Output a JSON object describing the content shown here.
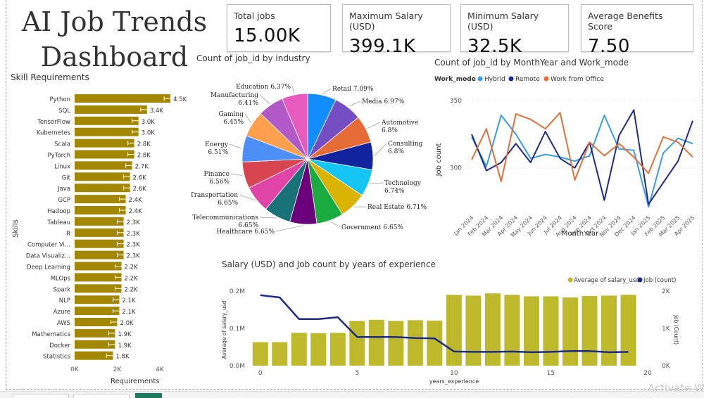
{
  "title": "AI Job Trends Dashboard",
  "kpis": [
    {
      "label": "Total jobs",
      "value": "15.00K"
    },
    {
      "label": "Maximum Salary (USD)",
      "value": "399.1K"
    },
    {
      "label": "Minimum Salary (USD)",
      "value": "32.5K"
    },
    {
      "label": "Average Benefits Score",
      "value": "7.50"
    }
  ],
  "watermark": "Activate W",
  "chart_data": [
    {
      "type": "bar",
      "orientation": "horizontal",
      "title": "Skill Requirements",
      "ylabel": "Skills",
      "xlabel": "Requirements",
      "xlim": [
        0,
        4500
      ],
      "xticks": [
        "0K",
        "2K",
        "4K"
      ],
      "xtick_values": [
        0,
        2000,
        4000
      ],
      "color": "#a48700",
      "error_bars": true,
      "categories": [
        "Python",
        "SQL",
        "TensorFlow",
        "Kubernetes",
        "Scala",
        "PyTorch",
        "Linux",
        "Git",
        "Java",
        "GCP",
        "Hadoop",
        "Tableau",
        "R",
        "Computer Vi...",
        "Data Visualiz...",
        "Deep Learning",
        "MLOps",
        "Spark",
        "NLP",
        "Azure",
        "AWS",
        "Mathematics",
        "Docker",
        "Statistics"
      ],
      "values": [
        4500,
        3400,
        3000,
        3000,
        2800,
        2800,
        2700,
        2600,
        2600,
        2400,
        2400,
        2300,
        2300,
        2300,
        2300,
        2200,
        2200,
        2200,
        2100,
        2100,
        2000,
        1900,
        1900,
        1800
      ],
      "labels": [
        "4.5K",
        "3.4K",
        "3.0K",
        "3.0K",
        "2.8K",
        "2.8K",
        "2.7K",
        "2.6K",
        "2.6K",
        "2.4K",
        "2.4K",
        "2.3K",
        "2.3K",
        "2.3K",
        "2.3K",
        "2.2K",
        "2.2K",
        "2.2K",
        "2.1K",
        "2.1K",
        "2.0K",
        "1.9K",
        "1.9K",
        "1.8K"
      ]
    },
    {
      "type": "pie",
      "title": "Count of job_id by industry",
      "slices": [
        {
          "name": "Retail",
          "pct": "7.09%",
          "value": 7.09,
          "color": "#118dff"
        },
        {
          "name": "Media",
          "pct": "6.97%",
          "value": 6.97,
          "color": "#744ec2"
        },
        {
          "name": "Automotive",
          "pct": "6.8%",
          "value": 6.8,
          "color": "#e66c37"
        },
        {
          "name": "Consulting",
          "pct": "6.8%",
          "value": 6.8,
          "color": "#12239e"
        },
        {
          "name": "Technology",
          "pct": "6.74%",
          "value": 6.74,
          "color": "#15c6f4"
        },
        {
          "name": "Real Estate",
          "pct": "6.71%",
          "value": 6.71,
          "color": "#d9b300"
        },
        {
          "name": "Government",
          "pct": "6.65%",
          "value": 6.65,
          "color": "#1aab40"
        },
        {
          "name": "Healthcare",
          "pct": "6.65%",
          "value": 6.65,
          "color": "#6b007b"
        },
        {
          "name": "Telecommunications",
          "pct": "6.65%",
          "value": 6.65,
          "color": "#197278"
        },
        {
          "name": "Transportation",
          "pct": "6.65%",
          "value": 6.65,
          "color": "#e044a7"
        },
        {
          "name": "Finance",
          "pct": "6.56%",
          "value": 6.56,
          "color": "#d64550"
        },
        {
          "name": "Energy",
          "pct": "6.51%",
          "value": 6.51,
          "color": "#4c8ff7"
        },
        {
          "name": "Gaming",
          "pct": "6.45%",
          "value": 6.45,
          "color": "#fe9f4d"
        },
        {
          "name": "Manufacturing",
          "pct": "6.41%",
          "value": 6.41,
          "color": "#b259c8"
        },
        {
          "name": "Education",
          "pct": "6.37%",
          "value": 6.37,
          "color": "#e85bbe"
        }
      ]
    },
    {
      "type": "line",
      "title": "Count of job_id by MonthYear and Work_mode",
      "xlabel": "MonthYear",
      "ylabel": "Job count",
      "ylim": [
        268,
        362
      ],
      "yticks": [
        300,
        350
      ],
      "legend_title": "Work_mode",
      "legend_position": "top-left",
      "x": [
        "Jan 2024",
        "Feb 2024",
        "Mar 2024",
        "Apr 2024",
        "May 2024",
        "Jun 2024",
        "Jul 2024",
        "Aug 2024",
        "Sep 2024",
        "Oct 2024",
        "Nov 2024",
        "Dec 2024",
        "Jan 2025",
        "Feb 2025",
        "Mar 2025",
        "Apr 2025"
      ],
      "series": [
        {
          "name": "Hybrid",
          "color": "#3a9ee6",
          "values": [
            323,
            301,
            339,
            325,
            307,
            310,
            308,
            305,
            309,
            339,
            314,
            313,
            271,
            311,
            322,
            318
          ]
        },
        {
          "name": "Remote",
          "color": "#1c2b8a",
          "values": [
            325,
            298,
            304,
            318,
            304,
            327,
            307,
            300,
            319,
            276,
            324,
            343,
            273,
            289,
            305,
            335
          ]
        },
        {
          "name": "Work from Office",
          "color": "#e0703a",
          "values": [
            306,
            329,
            290,
            340,
            336,
            329,
            341,
            291,
            319,
            309,
            318,
            308,
            296,
            323,
            319,
            308
          ]
        }
      ]
    },
    {
      "type": "bar+line",
      "title": "Salary (USD) and Job count by years of experience",
      "xlabel": "years_experience",
      "ylabel": "Average of salary_usd",
      "y2label": "Job (Count)",
      "xticks": [
        0,
        5,
        10,
        15,
        20
      ],
      "xlim": [
        -0.5,
        20
      ],
      "ylim": [
        0,
        200000
      ],
      "yticks": [
        "0.0M",
        "0.1M",
        "0.2M"
      ],
      "y2lim": [
        0,
        2000
      ],
      "y2ticks": [
        "0K",
        "1K",
        "2K"
      ],
      "legend_position": "top-right",
      "series": [
        {
          "name": "Average of salary_usd",
          "type": "bar",
          "color": "#bdb92a",
          "x": [
            0,
            1,
            2,
            3,
            4,
            5,
            6,
            7,
            8,
            9,
            10,
            11,
            12,
            13,
            14,
            15,
            16,
            17,
            18,
            19
          ],
          "values": [
            63000,
            63000,
            88000,
            87000,
            88000,
            120000,
            123000,
            120000,
            122000,
            121000,
            190000,
            188000,
            194000,
            190000,
            186000,
            186000,
            183000,
            187000,
            188000,
            190000
          ]
        },
        {
          "name": "Job (count)",
          "type": "line",
          "color": "#1c2b8a",
          "x": [
            0,
            1,
            2,
            3,
            4,
            5,
            6,
            7,
            8,
            9,
            10,
            11,
            12,
            13,
            14,
            15,
            16,
            17,
            18,
            19
          ],
          "values": [
            1890,
            1830,
            1250,
            1250,
            1300,
            770,
            770,
            770,
            740,
            730,
            380,
            370,
            370,
            380,
            360,
            370,
            390,
            390,
            360,
            370
          ]
        }
      ]
    }
  ]
}
